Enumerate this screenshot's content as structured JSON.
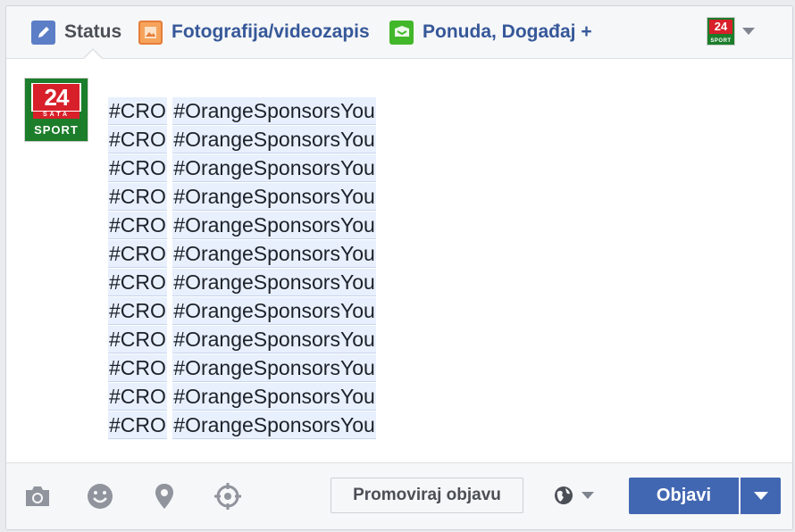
{
  "tabs": {
    "status": "Status",
    "photo": "Fotografija/videozapis",
    "offer": "Ponuda, Događaj +"
  },
  "page_avatar": {
    "number": "24",
    "sub": "SATA",
    "sport": "SPORT"
  },
  "post": {
    "lines": [
      [
        "#CRO",
        "#OrangeSponsorsYou"
      ],
      [
        "#CRO",
        "#OrangeSponsorsYou"
      ],
      [
        "#CRO",
        "#OrangeSponsorsYou"
      ],
      [
        "#CRO",
        "#OrangeSponsorsYou"
      ],
      [
        "#CRO",
        "#OrangeSponsorsYou"
      ],
      [
        "#CRO",
        "#OrangeSponsorsYou"
      ],
      [
        "#CRO",
        "#OrangeSponsorsYou"
      ],
      [
        "#CRO",
        "#OrangeSponsorsYou"
      ],
      [
        "#CRO",
        "#OrangeSponsorsYou"
      ],
      [
        "#CRO",
        "#OrangeSponsorsYou"
      ],
      [
        "#CRO",
        "#OrangeSponsorsYou"
      ],
      [
        "#CRO",
        "#OrangeSponsorsYou"
      ]
    ]
  },
  "actions": {
    "promote": "Promoviraj objavu",
    "post": "Objavi"
  },
  "colors": {
    "accent": "#4267b2",
    "link": "#365899",
    "hashtag_bg": "#e8f0fd"
  }
}
